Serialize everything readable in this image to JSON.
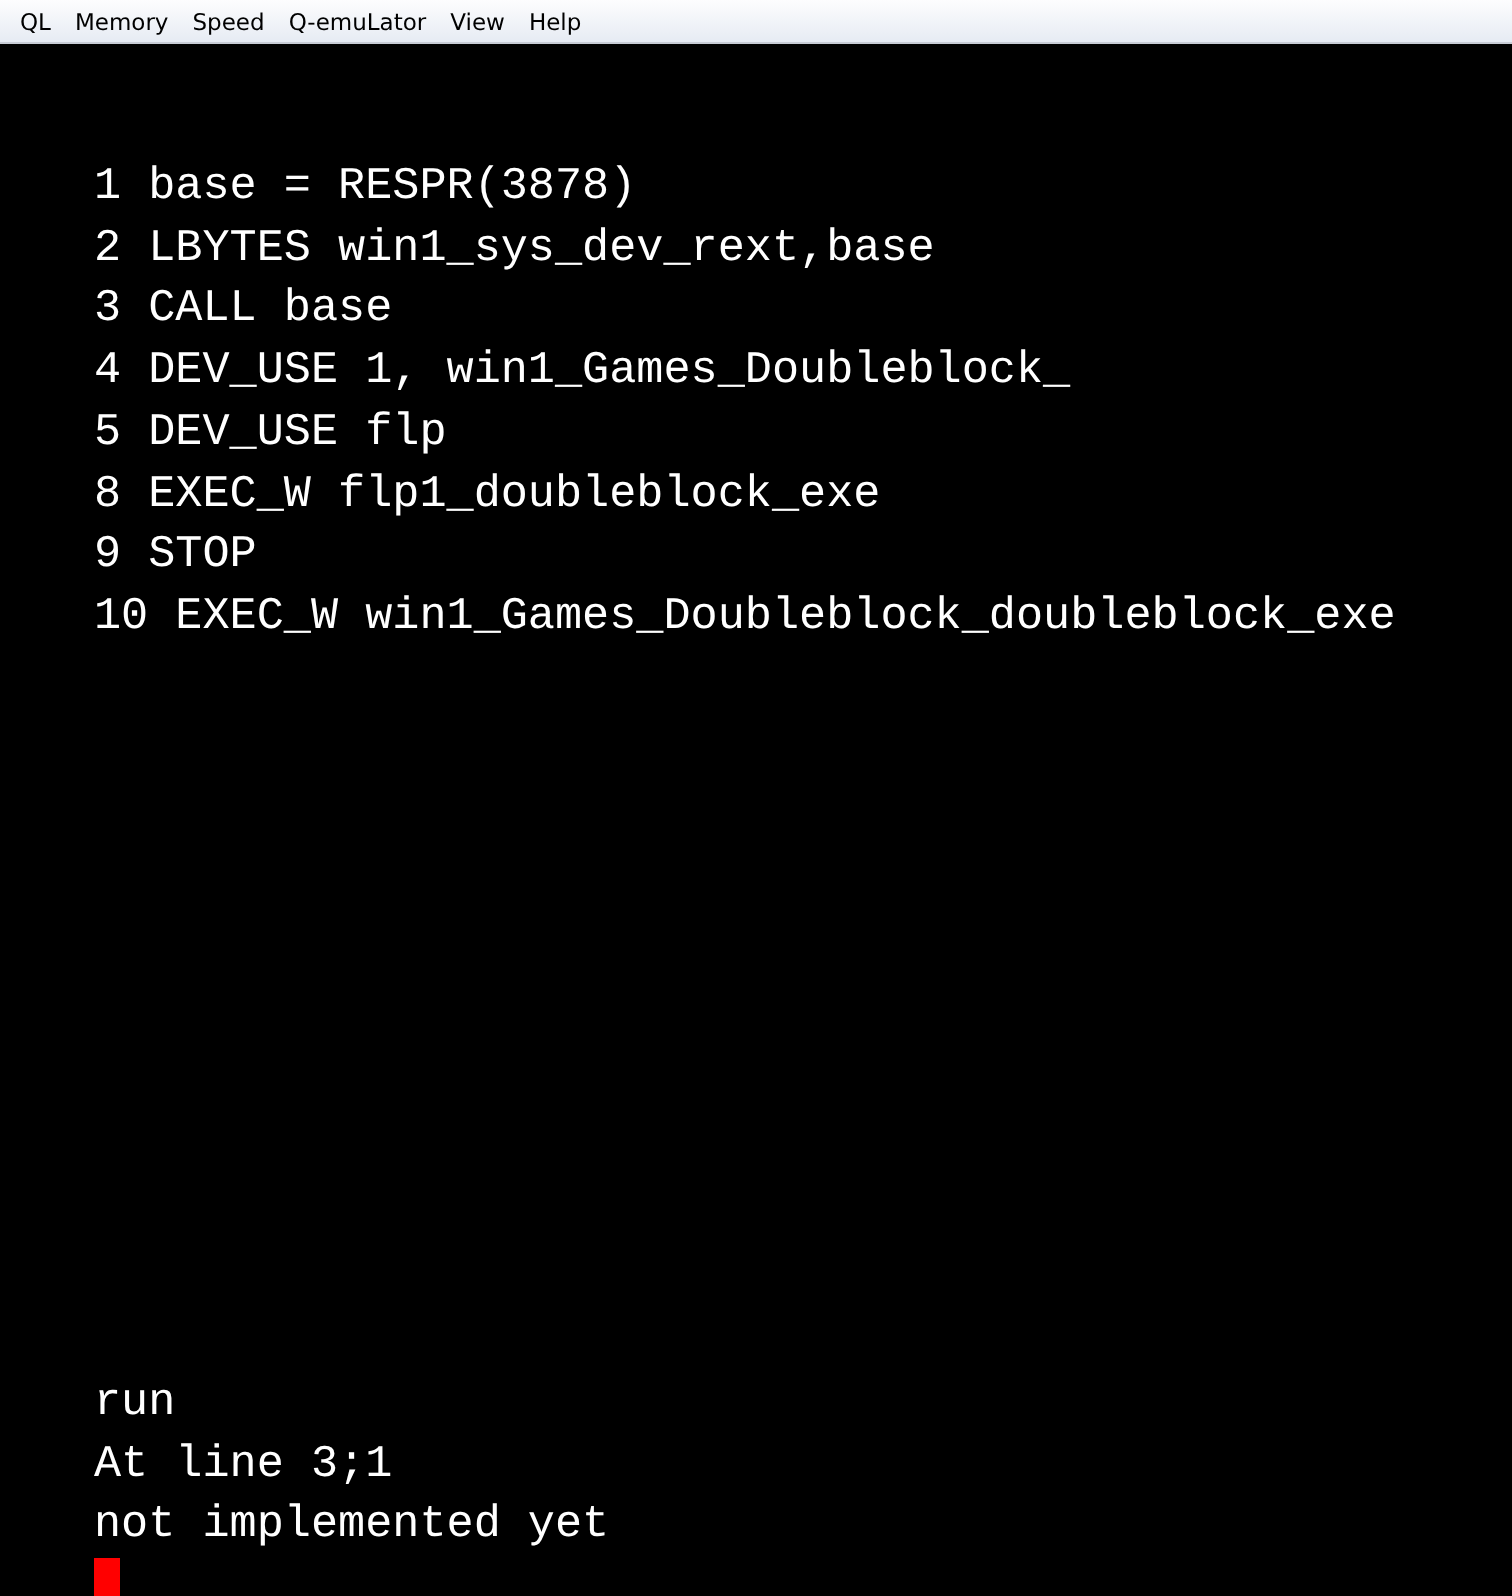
{
  "menu_bar": [
    "QL",
    "Memory",
    "Speed",
    "Q-emuLator",
    "View",
    "Help"
  ],
  "listing": [
    "1 base = RESPR(3878)",
    "2 LBYTES win1_sys_dev_rext,base",
    "3 CALL base",
    "4 DEV_USE 1, win1_Games_Doubleblock_",
    "5 DEV_USE flp",
    "8 EXEC_W flp1_doubleblock_exe",
    "9 STOP",
    "10 EXEC_W win1_Games_Doubleblock_doubleblock_exe"
  ],
  "console": [
    "run",
    "At line 3;1",
    "not implemented yet"
  ]
}
